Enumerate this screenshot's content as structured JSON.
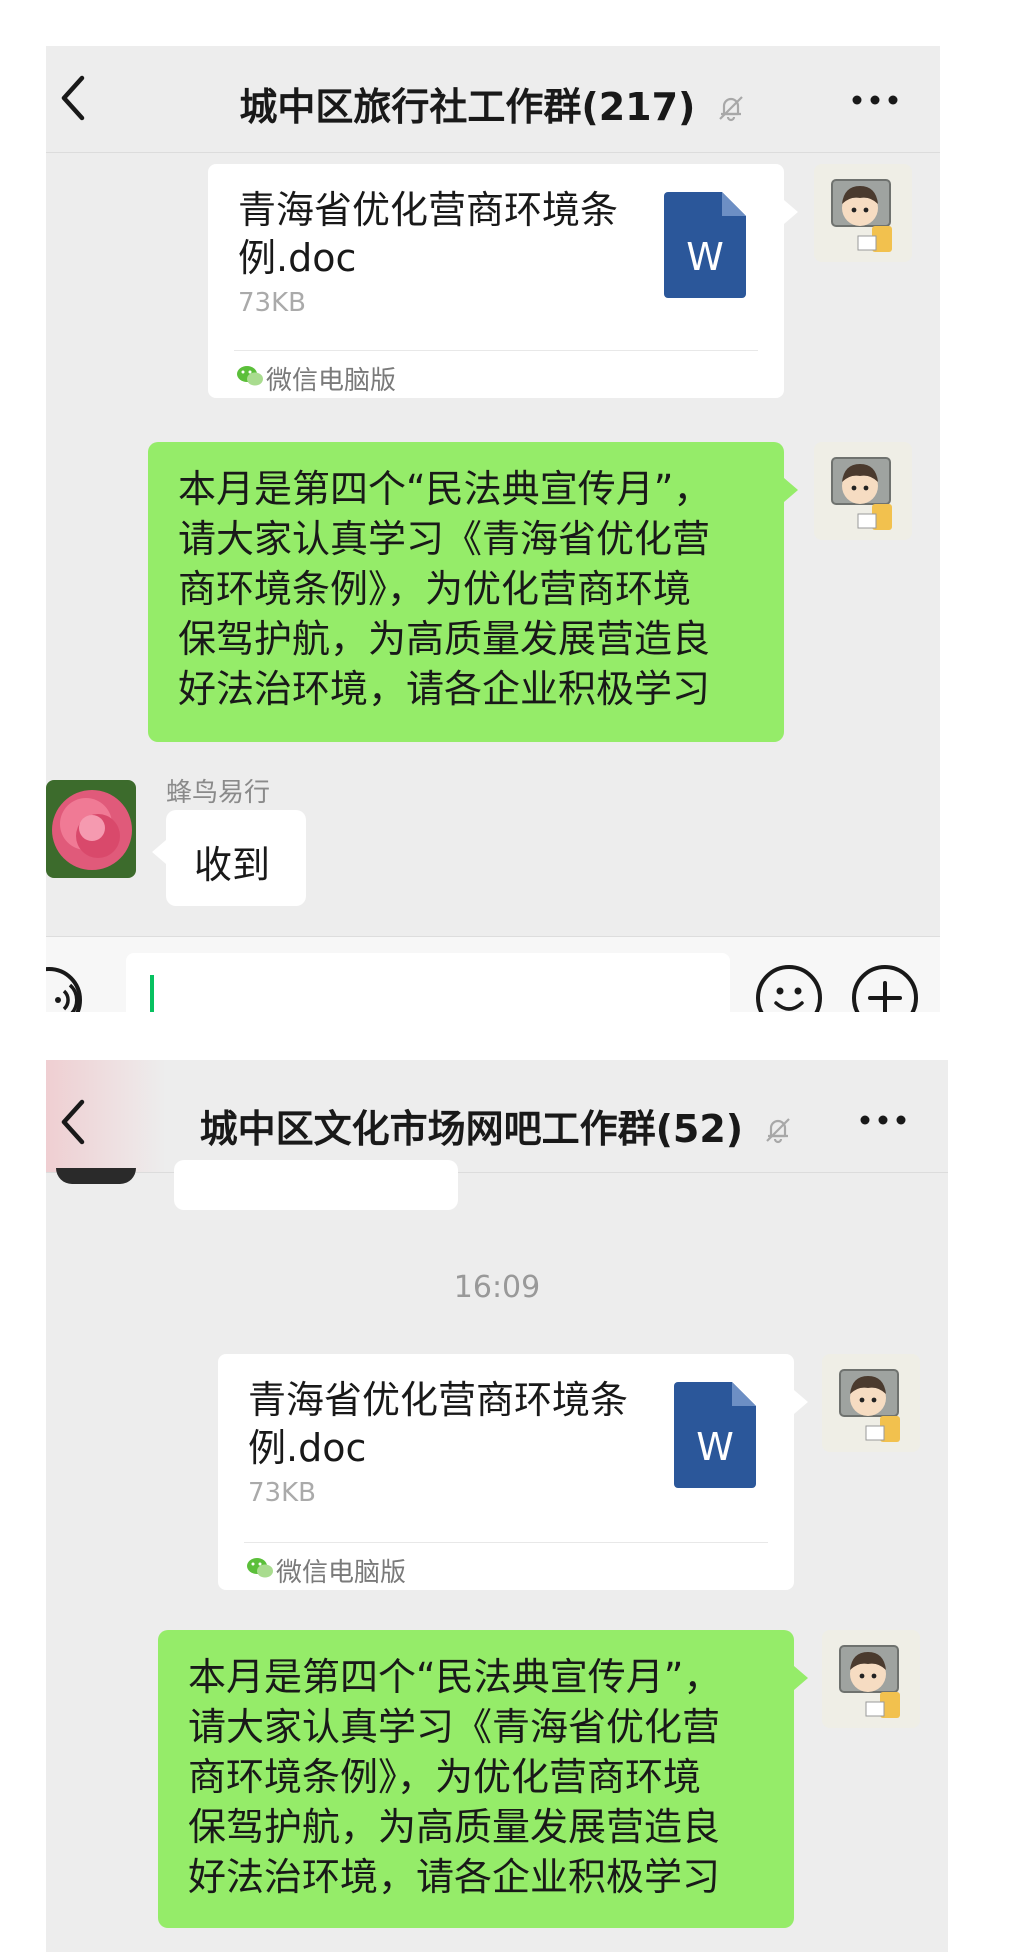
{
  "chat1": {
    "title": "城中区旅行社工作群(217)",
    "file": {
      "name": "青海省优化营商环境条例.doc",
      "size": "73KB",
      "source": "微信电脑版"
    },
    "message_lines": [
      "本月是第四个“民法典宣传月”，",
      "请大家认真学习《青海省优化营",
      "商环境条例》，为优化营商环境",
      "保驾护航，为高质量发展营造良",
      "好法治环境，请各企业积极学习"
    ],
    "reply": {
      "sender": "蜂鸟易行",
      "text": "收到"
    }
  },
  "chat2": {
    "title": "城中区文化市场网吧工作群(52)",
    "timestamp": "16:09",
    "file": {
      "name": "青海省优化营商环境条例.doc",
      "size": "73KB",
      "source": "微信电脑版"
    },
    "message_lines": [
      "本月是第四个“民法典宣传月”，",
      "请大家认真学习《青海省优化营",
      "商环境条例》，为优化营商环境",
      "保驾护航，为高质量发展营造良",
      "好法治环境，请各企业积极学习"
    ]
  },
  "icons": [
    "back-arrow-icon",
    "mute-bell-icon",
    "more-icon",
    "word-doc-icon",
    "wechat-mini-icon",
    "voice-icon",
    "emoji-icon",
    "plus-icon"
  ],
  "colors": {
    "background": "#ededed",
    "my_bubble": "#95ec69",
    "word_blue": "#2b579a",
    "input_caret": "#07c160"
  }
}
